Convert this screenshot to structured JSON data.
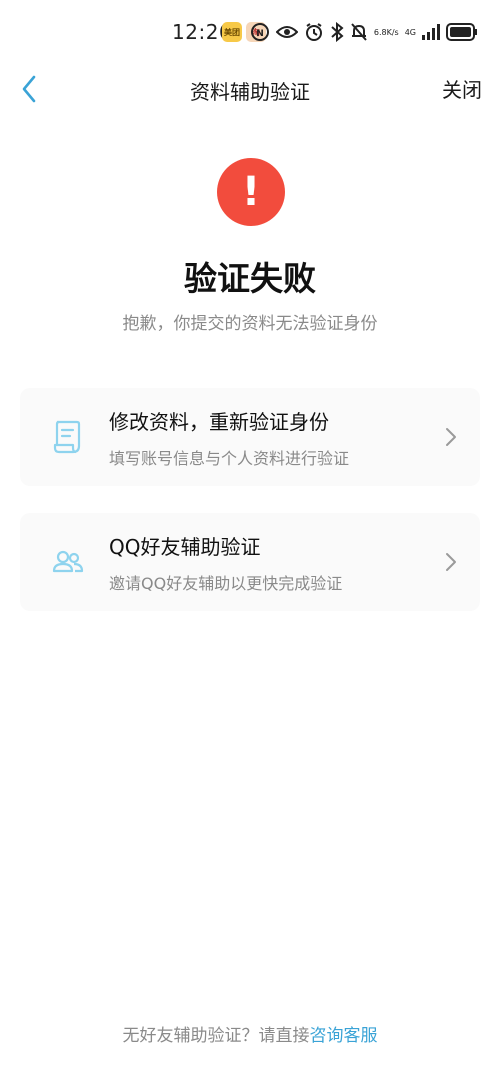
{
  "status_bar": {
    "time": "12:26",
    "badge_1": "美团",
    "badge_2": "淘",
    "net_speed_value": "6.8",
    "net_speed_unit": "K/s",
    "network_type": "4G"
  },
  "nav": {
    "title": "资料辅助验证",
    "close_label": "关闭"
  },
  "result": {
    "icon": "error-exclamation-icon",
    "mark": "!",
    "title": "验证失败",
    "subtitle": "抱歉，你提交的资料无法验证身份",
    "accent_color": "#f24c3d"
  },
  "options": [
    {
      "icon": "document-icon",
      "title": "修改资料，重新验证身份",
      "description": "填写账号信息与个人资料进行验证"
    },
    {
      "icon": "friends-icon",
      "title": "QQ好友辅助验证",
      "description": "邀请QQ好友辅助以更快完成验证"
    }
  ],
  "footer": {
    "text": "无好友辅助验证？请直接",
    "link": "咨询客服",
    "link_color": "#3aa3d6"
  }
}
